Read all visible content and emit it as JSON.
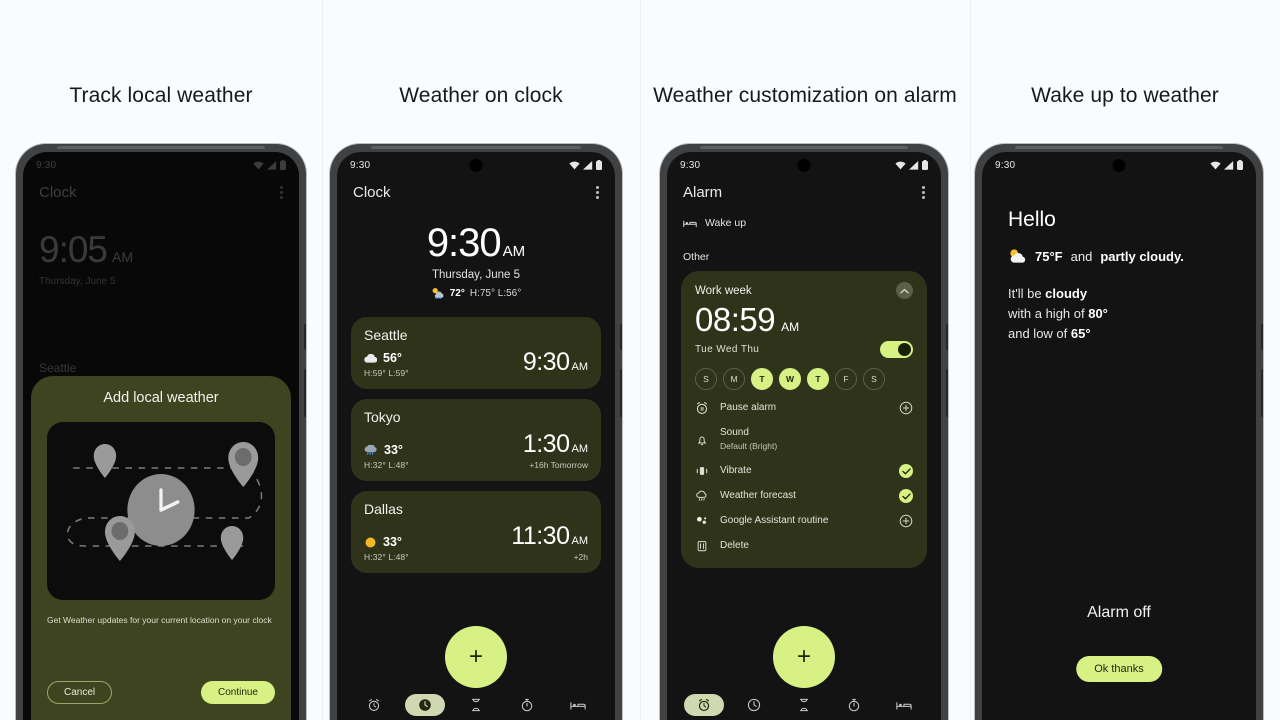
{
  "panels": [
    {
      "headline": "Track local weather",
      "status": {
        "time": "9:30",
        "icons": [
          "wifi-icon",
          "cellular-icon",
          "battery-icon"
        ]
      },
      "appbar": {
        "title": "Clock",
        "menu": "overflow-menu-icon"
      },
      "clock": {
        "time": "9:05",
        "ampm": "AM",
        "date": "Thursday, June 5"
      },
      "city": {
        "name": "Seattle"
      },
      "dialog": {
        "title": "Add local weather",
        "description": "Get Weather updates for your current location on your clock",
        "cancel": "Cancel",
        "continue": "Continue",
        "illustration": "map-pins-clock-illustration"
      }
    },
    {
      "headline": "Weather on clock",
      "status": {
        "time": "9:30"
      },
      "appbar": {
        "title": "Clock",
        "menu": "overflow-menu-icon"
      },
      "clock": {
        "time": "9:30",
        "ampm": "AM",
        "date": "Thursday, June 5",
        "weather_icon": "rain-sun-icon",
        "temp": "72°",
        "high_low": "H:75° L:56°"
      },
      "cities": [
        {
          "name": "Seattle",
          "icon": "cloud-icon",
          "temp": "56°",
          "high_low": "H:59° L:59°",
          "time": "9:30",
          "ampm": "AM",
          "offset": ""
        },
        {
          "name": "Tokyo",
          "icon": "rain-cloud-icon",
          "temp": "33°",
          "high_low": "H:32° L:48°",
          "time": "1:30",
          "ampm": "AM",
          "offset": "+16h  Tomorrow"
        },
        {
          "name": "Dallas",
          "icon": "sun-icon",
          "temp": "33°",
          "high_low": "H:32° L:48°",
          "time": "11:30",
          "ampm": "AM",
          "offset": "+2h"
        }
      ],
      "fab": "+",
      "nav": [
        "alarm-tab",
        "clock-tab",
        "timer-tab",
        "stopwatch-tab",
        "bedtime-tab"
      ],
      "nav_active_index": 1
    },
    {
      "headline": "Weather customization on alarm",
      "status": {
        "time": "9:30"
      },
      "appbar": {
        "title": "Alarm",
        "menu": "overflow-menu-icon"
      },
      "sections": [
        {
          "icon": "bed-icon",
          "label": "Wake up"
        },
        {
          "label": "Other"
        }
      ],
      "alarm": {
        "label": "Work week",
        "time": "08:59",
        "ampm": "AM",
        "days_text": "Tue  Wed  Thu",
        "enabled": true,
        "day_chips": [
          {
            "letter": "S",
            "on": false
          },
          {
            "letter": "M",
            "on": false
          },
          {
            "letter": "T",
            "on": true
          },
          {
            "letter": "W",
            "on": true
          },
          {
            "letter": "T",
            "on": true
          },
          {
            "letter": "F",
            "on": false
          },
          {
            "letter": "S",
            "on": false
          }
        ],
        "options": [
          {
            "icon": "alarm-clock-icon",
            "label": "Pause alarm",
            "sub": "",
            "end": "plus"
          },
          {
            "icon": "bell-icon",
            "label": "Sound",
            "sub": "Default (Bright)",
            "end": "none"
          },
          {
            "icon": "vibrate-icon",
            "label": "Vibrate",
            "sub": "",
            "end": "check"
          },
          {
            "icon": "cloud-rain-icon",
            "label": "Weather forecast",
            "sub": "",
            "end": "check"
          },
          {
            "icon": "assistant-icon",
            "label": "Google Assistant routine",
            "sub": "",
            "end": "plus"
          },
          {
            "icon": "trash-icon",
            "label": "Delete",
            "sub": "",
            "end": "none"
          }
        ]
      },
      "fab": "+",
      "nav": [
        "alarm-tab",
        "clock-tab",
        "timer-tab",
        "stopwatch-tab",
        "bedtime-tab"
      ],
      "nav_active_index": 0
    },
    {
      "headline": "Wake up to weather",
      "status": {
        "time": "9:30"
      },
      "greeting": "Hello",
      "now": {
        "icon": "partly-cloudy-icon",
        "temp": "75°F",
        "joiner": "and",
        "condition": "partly cloudy."
      },
      "forecast": {
        "line1_prefix": "It'll be ",
        "line1_bold": "cloudy",
        "line2_prefix": "with a high of ",
        "line2_bold": "80°",
        "line3_prefix": "and low of ",
        "line3_bold": "65°"
      },
      "alarm_off": "Alarm off",
      "ok_button": "Ok thanks"
    }
  ],
  "colors": {
    "page_background": "#fafbfc",
    "accent_lime": "#d7f185",
    "card_olive": "#2f331a",
    "dialog_olive": "#3e4420",
    "screen_black": "#131314",
    "frame_gray": "#3f4143"
  }
}
